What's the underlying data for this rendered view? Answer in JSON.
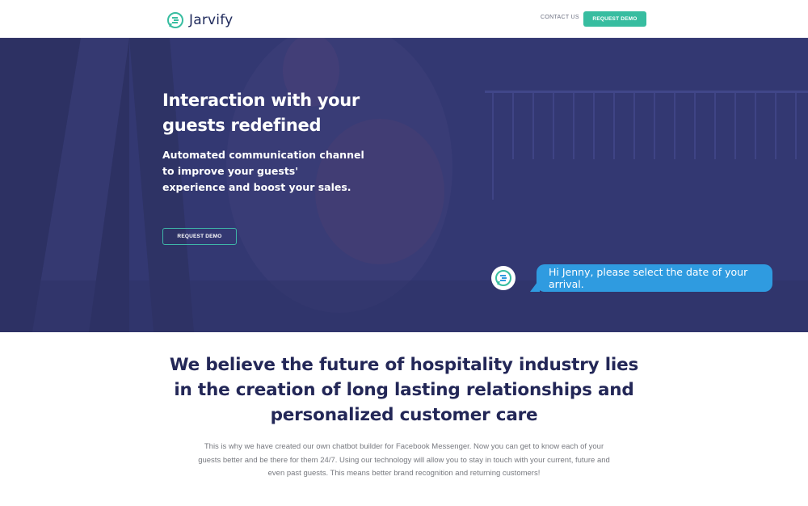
{
  "header": {
    "brand": "Jarvify",
    "nav_contact": "CONTACT US",
    "nav_demo": "REQUEST DEMO"
  },
  "hero": {
    "title": "Interaction with your guests redefined",
    "subtitle": "Automated communication channel to improve your guests' experience and boost your sales.",
    "cta": "REQUEST DEMO",
    "chat_message": "Hi Jenny, please select the date of your arrival."
  },
  "section": {
    "title": "We believe the future of hospitality industry lies in the creation of long lasting relationships and personalized customer care",
    "text": "This is why we have created our own chatbot builder for Facebook Messenger. Now you can get to know each of your guests better and be there for them 24/7. Using our technology will allow you to stay in touch with your current, future and even past guests. This means better brand recognition and returning customers!"
  },
  "icons": {
    "logo": "chat-bubble-logo-icon",
    "bot_avatar": "chat-bot-avatar-icon"
  },
  "colors": {
    "accent": "#37bda0",
    "hero_overlay": "#353a78",
    "bubble": "#2f9be0",
    "heading": "#232757"
  }
}
